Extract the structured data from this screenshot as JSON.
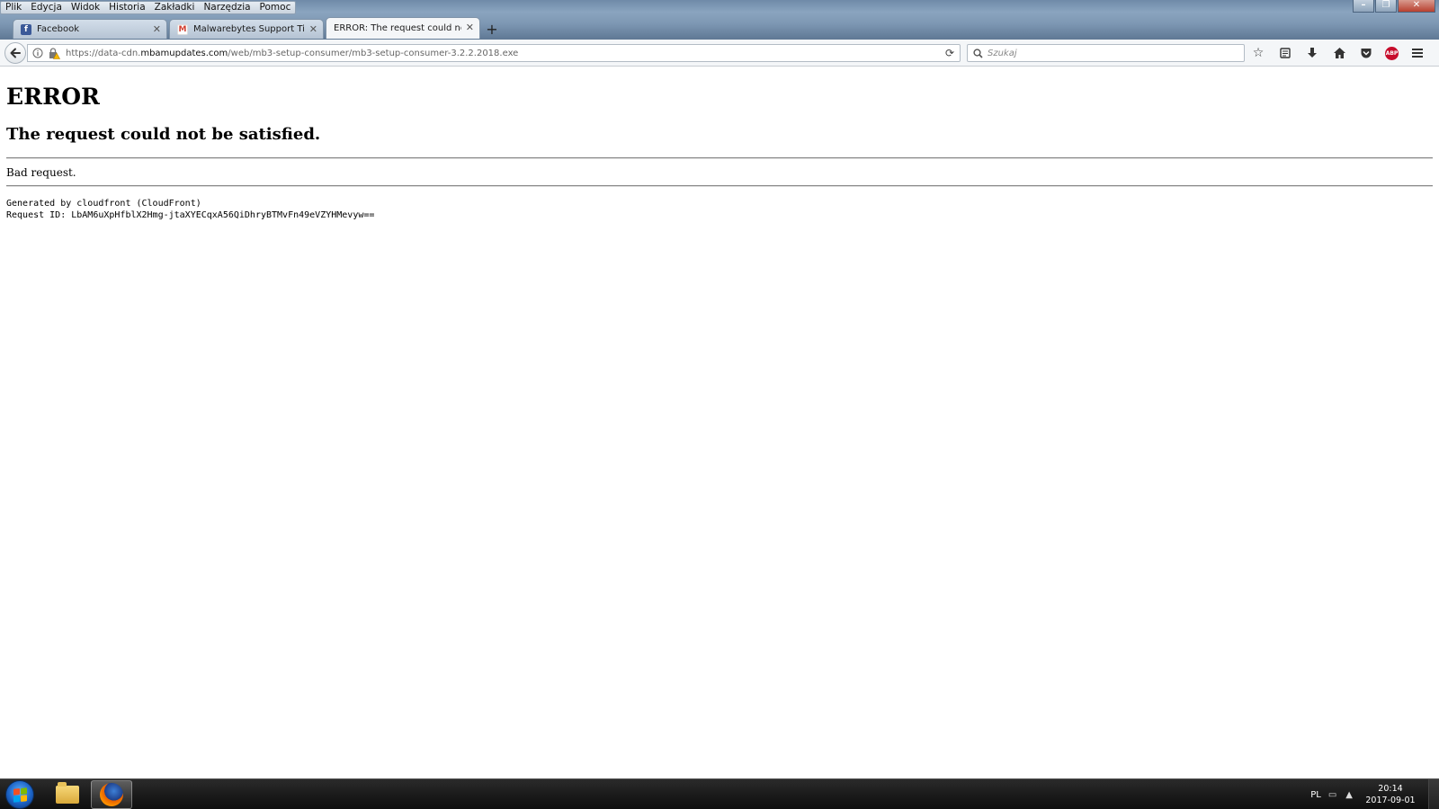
{
  "menu": [
    "Plik",
    "Edycja",
    "Widok",
    "Historia",
    "Zakładki",
    "Narzędzia",
    "Pomoc"
  ],
  "tabs": [
    {
      "title": "Facebook",
      "icon": "facebook-icon",
      "active": false
    },
    {
      "title": "Malwarebytes Support Ticket",
      "icon": "gmail-icon",
      "active": false
    },
    {
      "title": "ERROR: The request could not be satisfied.",
      "icon": "none",
      "active": true
    }
  ],
  "new_tab_label": "+",
  "address": {
    "prefix": "https://data-cdn.",
    "host": "mbamupdates.com",
    "path": "/web/mb3-setup-consumer/mb3-setup-consumer-3.2.2.2018.exe"
  },
  "search": {
    "placeholder": "Szukaj"
  },
  "toolbar_icons": [
    "bookmark-star-icon",
    "reading-list-icon",
    "download-icon",
    "home-icon",
    "pocket-icon",
    "adblock-plus-icon",
    "hamburger-menu-icon"
  ],
  "abp_label": "ABP",
  "page": {
    "heading": "ERROR",
    "subheading": "The request could not be satisfied.",
    "message": "Bad request.",
    "generated_by": "Generated by cloudfront (CloudFront)",
    "request_id": "Request ID: LbAM6uXpHfblX2Hmg-jtaXYECqxA56QiDhryBTMvFn49eVZYHMevyw=="
  },
  "taskbar": {
    "language": "PL",
    "time": "20:14",
    "date": "2017-09-01"
  },
  "colors": {
    "abp_red": "#c70d2c",
    "facebook_blue": "#3b5998",
    "gmail_red": "#d23f31"
  }
}
